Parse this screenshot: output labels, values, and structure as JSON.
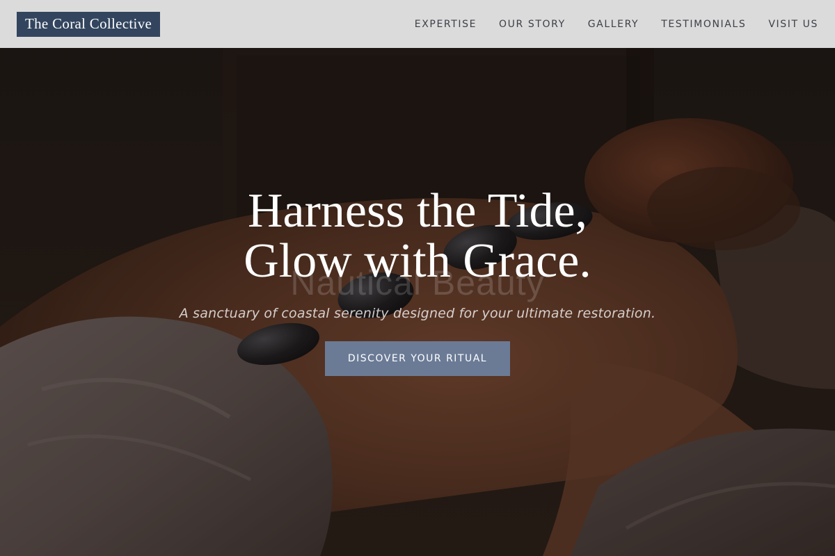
{
  "brand": {
    "name": "The Coral Collective",
    "color": "#33455e"
  },
  "nav": {
    "items": [
      {
        "label": "EXPERTISE"
      },
      {
        "label": "OUR STORY"
      },
      {
        "label": "GALLERY"
      },
      {
        "label": "TESTIMONIALS"
      },
      {
        "label": "VISIT US"
      }
    ]
  },
  "hero": {
    "headline_line1": "Harness the Tide,",
    "headline_line2": "Glow with Grace.",
    "watermark": "Nautical Beauty",
    "subtitle": "A sanctuary of coastal serenity designed for your ultimate restoration.",
    "cta_label": "DISCOVER YOUR RITUAL",
    "cta_color": "#6b7b96"
  }
}
